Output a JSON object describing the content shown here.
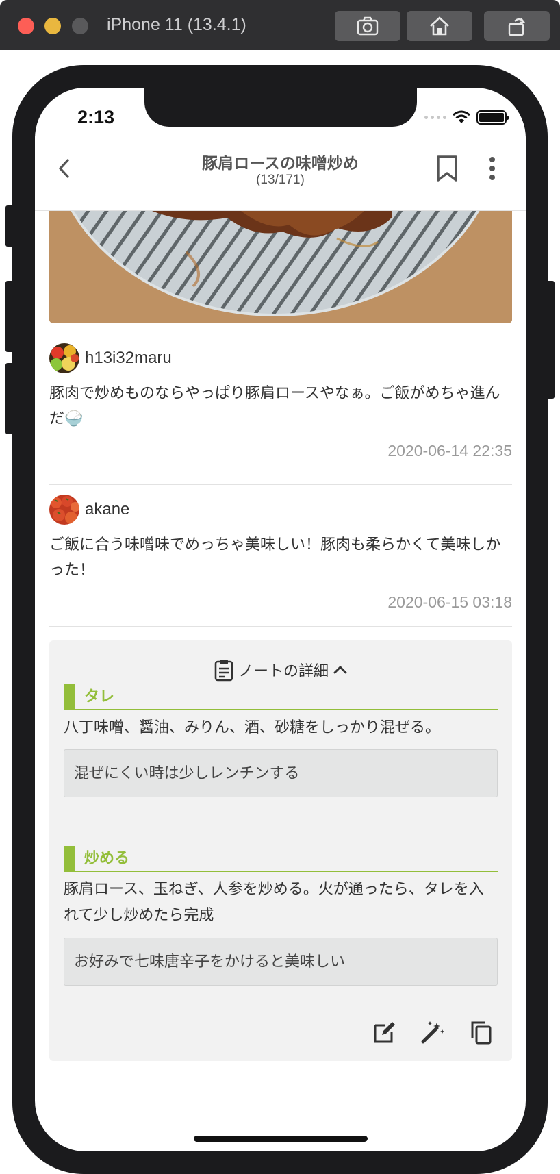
{
  "simulator": {
    "title": "iPhone 11 (13.4.1)",
    "buttons": [
      "screenshot",
      "home",
      "rotate"
    ]
  },
  "status": {
    "time": "2:13"
  },
  "nav": {
    "title": "豚肩ロースの味噌炒め",
    "subtitle": "(13/171)"
  },
  "comments": [
    {
      "user": "h13i32maru",
      "text": "豚肉で炒めものならやっぱり豚肩ロースやなぁ。ご飯がめちゃ進んだ🍚",
      "date": "2020-06-14 22:35"
    },
    {
      "user": "akane",
      "text": "ご飯に合う味噌味でめっちゃ美味しい！豚肉も柔らかくて美味しかった！",
      "date": "2020-06-15 03:18"
    }
  ],
  "notes": {
    "header": "ノートの詳細",
    "sections": [
      {
        "title": "タレ",
        "text": "八丁味噌、醤油、みりん、酒、砂糖をしっかり混ぜる。",
        "tip": "混ぜにくい時は少しレンチンする"
      },
      {
        "title": "炒める",
        "text": "豚肩ロース、玉ねぎ、人参を炒める。火が通ったら、タレを入れて少し炒めたら完成",
        "tip": "お好みで七味唐辛子をかけると美味しい"
      }
    ]
  },
  "colors": {
    "accent": "#93be3a",
    "date": "#9a9a9a",
    "panel": "#f2f2f2"
  }
}
